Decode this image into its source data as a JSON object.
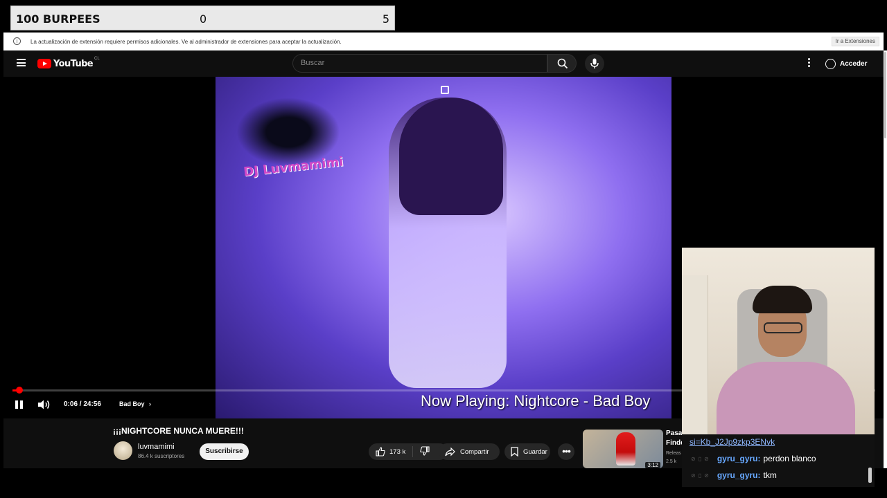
{
  "burpee_counter": {
    "label": "100 BURPEES",
    "count": "0",
    "goal": "5"
  },
  "infobar": {
    "icon": "info-icon",
    "message": "La actualización de extensión requiere permisos adicionales. Ve al administrador de extensiones para aceptar la actualización.",
    "button": "Ir a Extensiones"
  },
  "header": {
    "logo_text": "YouTube",
    "region": "CL",
    "search_placeholder": "Buscar",
    "signin_label": "Acceder"
  },
  "player": {
    "overlay_text": "DJ Luvmamimi",
    "now_playing": "Now Playing: Nightcore - Bad Boy",
    "time": "0:06 / 24:56",
    "chapter": "Bad Boy",
    "progress_fraction": 0.004
  },
  "video": {
    "title": "¡¡¡NIGHTCORE NUNCA MUERE!!!",
    "channel": "luvmamimi",
    "subscribers": "86.4 k suscriptores",
    "subscribe_label": "Suscribirse",
    "likes": "173 k",
    "share_label": "Compartir",
    "save_label": "Guardar"
  },
  "related": {
    "title_line1": "Pasa",
    "title_line2": "Finde",
    "meta_line1": "Releas",
    "meta_line2": "2.5 k",
    "duration": "3:12"
  },
  "chat": {
    "url_text": "si=Kb_J2Jp9zkp3ENvk",
    "messages": [
      {
        "user": "gyru_gyru:",
        "text": "perdon blanco"
      },
      {
        "user": "gyru_gyru:",
        "text": "tkm"
      }
    ]
  },
  "colors": {
    "accent": "#ff0000",
    "chat_user": "#67a8ff"
  }
}
